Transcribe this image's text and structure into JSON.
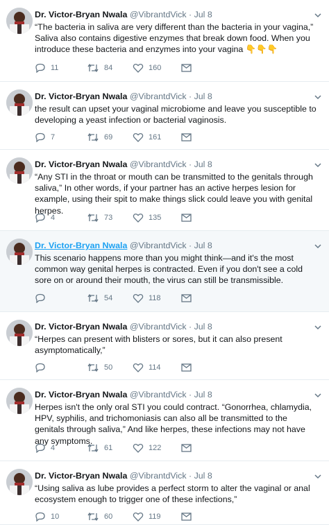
{
  "tweets": [
    {
      "name": "Dr. Victor-Bryan Nwala",
      "handle": "@VibrantdVick",
      "date": "Jul 8",
      "text": "“The bacteria in saliva are very different than the bacteria in your vagina,” Saliva also contains digestive enzymes that break down food. When you introduce these bacteria and enzymes into your vagina 👇👇👇",
      "replies": "11",
      "retweets": "84",
      "likes": "160"
    },
    {
      "name": "Dr. Victor-Bryan Nwala",
      "handle": "@VibrantdVick",
      "date": "Jul 8",
      "text": "the result can upset your vaginal microbiome and leave you susceptible to developing a yeast infection or bacterial vaginosis.",
      "replies": "7",
      "retweets": "69",
      "likes": "161"
    },
    {
      "name": "Dr. Victor-Bryan Nwala",
      "handle": "@VibrantdVick",
      "date": "Jul 8",
      "text": "“Any STI in the throat or mouth can be transmitted to the genitals through saliva,” In other words, if your partner has an active herpes lesion for example, using their spit to make things slick could leave you with genital herpes.",
      "replies": "4",
      "retweets": "73",
      "likes": "135"
    },
    {
      "name": "Dr. Victor-Bryan Nwala",
      "handle": "@VibrantdVick",
      "date": "Jul 8",
      "text": "This scenario happens more than you might think—and it's the most common way genital herpes is contracted. Even if you don't see a cold sore on or around their mouth, the virus can still be transmissible.",
      "replies": "",
      "retweets": "54",
      "likes": "118"
    },
    {
      "name": "Dr. Victor-Bryan Nwala",
      "handle": "@VibrantdVick",
      "date": "Jul 8",
      "text": "“Herpes can present with blisters or sores, but it can also present asymptomatically,”",
      "replies": "",
      "retweets": "50",
      "likes": "114"
    },
    {
      "name": "Dr. Victor-Bryan Nwala",
      "handle": "@VibrantdVick",
      "date": "Jul 8",
      "text": "Herpes isn't the only oral STI you could contract. “Gonorrhea, chlamydia, HPV, syphilis, and trichomoniasis can also all be transmitted to the genitals through saliva,” And like herpes, these infections may not have any symptoms.",
      "replies": "4",
      "retweets": "61",
      "likes": "122"
    },
    {
      "name": "Dr. Victor-Bryan Nwala",
      "handle": "@VibrantdVick",
      "date": "Jul 8",
      "text": "“Using saliva as lube provides a perfect storm to alter the vaginal or anal ecosystem enough to trigger one of these infections,”",
      "replies": "10",
      "retweets": "60",
      "likes": "119"
    }
  ],
  "separator": "·",
  "colors": {
    "text": "#14171a",
    "meta": "#657786",
    "link": "#1da1f2",
    "highlight": "#f5f8fa"
  },
  "icons": [
    "avatar",
    "reply-icon",
    "retweet-icon",
    "like-icon",
    "dm-icon",
    "caret-down-icon"
  ]
}
